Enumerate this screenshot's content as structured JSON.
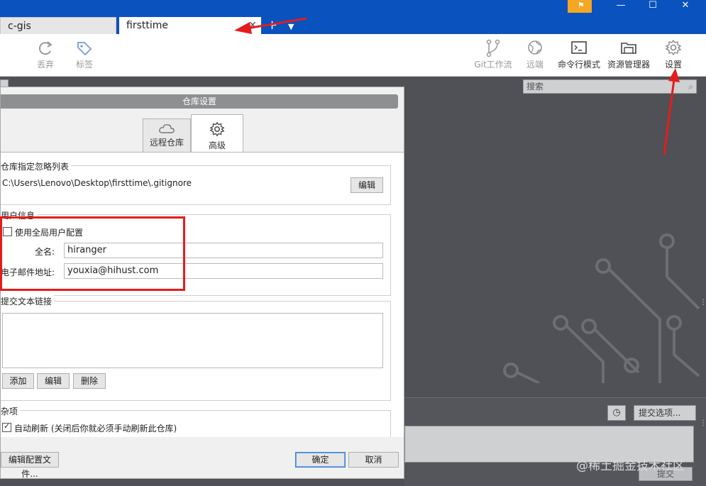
{
  "tabs": [
    {
      "label": "c-gis",
      "active": false
    },
    {
      "label": "firsttime",
      "active": true
    }
  ],
  "tab_add": "+",
  "tab_close": "✕",
  "window_controls": {
    "minimize": "—",
    "maximize": "☐",
    "close": "✕"
  },
  "toolbar": {
    "left": [
      {
        "label": "丢弃",
        "icon": "discard-icon"
      },
      {
        "label": "标签",
        "icon": "tag-icon"
      }
    ],
    "right": [
      {
        "label": "Git工作流",
        "icon": "git-flow-icon"
      },
      {
        "label": "远端",
        "icon": "remote-icon"
      },
      {
        "label": "命令行模式",
        "icon": "terminal-icon"
      },
      {
        "label": "资源管理器",
        "icon": "explorer-icon"
      },
      {
        "label": "设置",
        "icon": "gear-icon"
      }
    ]
  },
  "workspace": {
    "search_placeholder": "搜索",
    "commit_options": "提交选项...",
    "commit_button": "提交"
  },
  "dialog": {
    "title": "仓库设置",
    "tabs": [
      {
        "label": "远程仓库",
        "icon": "cloud-icon"
      },
      {
        "label": "高级",
        "icon": "gear-icon",
        "active": true
      }
    ],
    "ignore": {
      "label": "仓库指定忽略列表",
      "path": "C:\\Users\\Lenovo\\Desktop\\firsttime\\.gitignore",
      "edit_button": "编辑"
    },
    "user_info": {
      "label": "用户信息",
      "use_global_label": "使用全局用户配置",
      "use_global_checked": false,
      "fullname_label": "全名:",
      "fullname_value": "hiranger",
      "email_label": "电子邮件地址:",
      "email_value": "youxia@hihust.com"
    },
    "commit_links": {
      "label": "提交文本链接",
      "add_button": "添加",
      "edit_button": "编辑",
      "delete_button": "删除"
    },
    "misc": {
      "label": "杂项",
      "auto_refresh_label": "自动刷新 (关闭后你就必须手动刷新此仓库)",
      "auto_refresh_checked": true
    },
    "footer": {
      "edit_config": "编辑配置文件...",
      "ok": "确定",
      "cancel": "取消"
    }
  },
  "watermark": "@稀土掘金技术社区",
  "colors": {
    "titlebar": "#0a52be",
    "annotation_red": "#e51c1c",
    "flag": "#f5a623"
  }
}
